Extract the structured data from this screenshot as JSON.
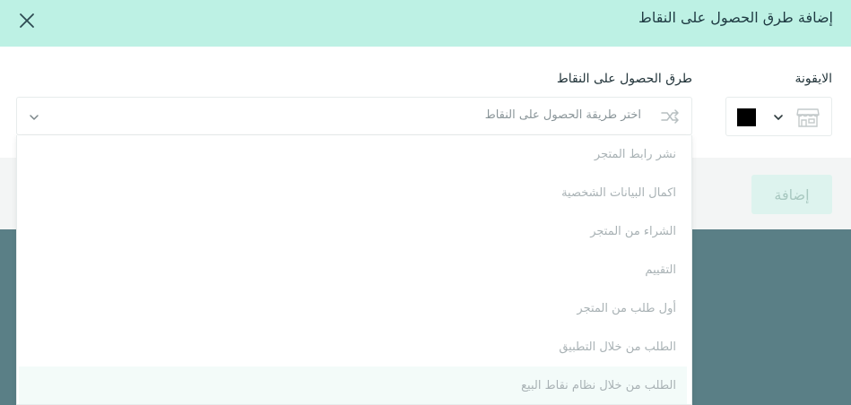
{
  "modal": {
    "title": "إضافة طرق الحصول على النقاط",
    "icon_label": "الايقونة",
    "method_label": "طرق الحصول على النقاط",
    "selected_color": "#000000",
    "method_placeholder": "اختر طريقة الحصول على النقاط",
    "add_button": "إضافة"
  },
  "dropdown": {
    "options": [
      "نشر رابط المتجر",
      "اكمال البيانات الشخصية",
      "الشراء من المتجر",
      "التقييم",
      "أول طلب من المتجر",
      "الطلب من خلال التطبيق",
      "الطلب من خلال نظام نقاط البيع"
    ],
    "highlighted_index": 6
  },
  "colors": {
    "header_bg": "#bdf1e4",
    "overlay": "#5a7f86",
    "button_disabled_bg": "#ddf3ee",
    "button_disabled_text": "#a8c8c0"
  },
  "icons": [
    "close-icon",
    "chevron-down-icon",
    "store-icon",
    "share-icon"
  ]
}
